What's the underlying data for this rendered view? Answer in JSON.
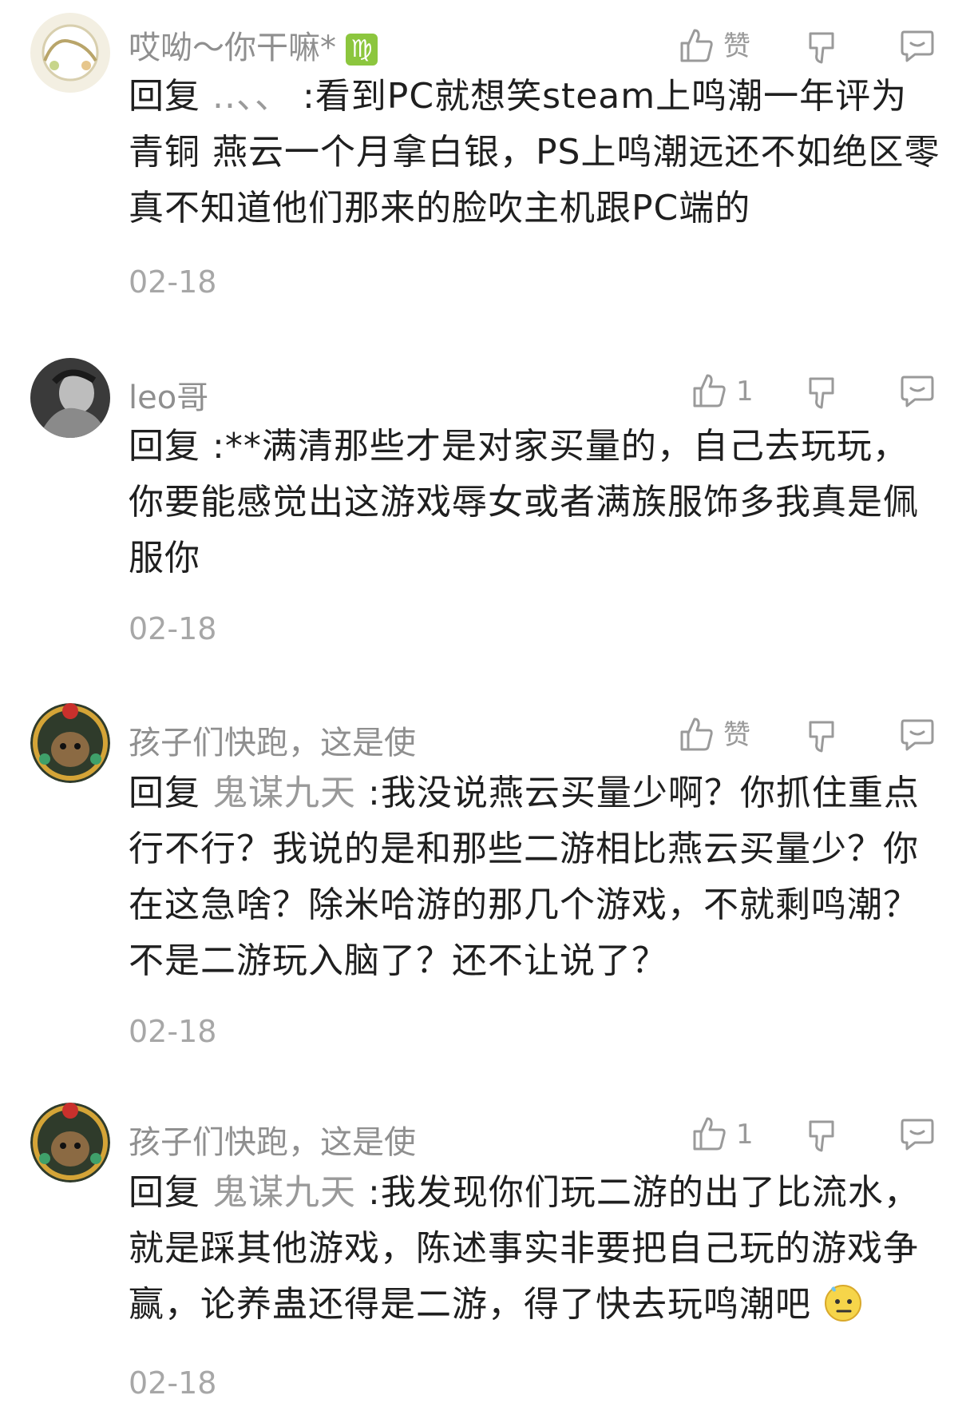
{
  "comments": [
    {
      "username": "哎呦～你干嘛*",
      "badge": "♍",
      "like_label": "赞",
      "reply_prefix": "回复",
      "mention": "..、、",
      "text": ":看到PC就想笑steam上鸣潮一年评为青铜 燕云一个月拿白银，PS上鸣潮远还不如绝区零真不知道他们那来的脸吹主机跟PC端的",
      "date": "02-18"
    },
    {
      "username": "leo哥",
      "like_label": "1",
      "reply_prefix": "回复",
      "mention": "",
      "text": ":**满清那些才是对家买量的，自己去玩玩，你要能感觉出这游戏辱女或者满族服饰多我真是佩服你",
      "date": "02-18"
    },
    {
      "username": "孩子们快跑，这是使",
      "like_label": "赞",
      "reply_prefix": "回复",
      "mention": "鬼谋九天",
      "text": ":我没说燕云买量少啊？你抓住重点行不行？我说的是和那些二游相比燕云买量少？你在这急啥？除米哈游的那几个游戏，不就剩鸣潮？不是二游玩入脑了？还不让说了？",
      "date": "02-18"
    },
    {
      "username": "孩子们快跑，这是使",
      "like_label": "1",
      "reply_prefix": "回复",
      "mention": "鬼谋九天",
      "text": ":我发现你们玩二游的出了比流水，就是踩其他游戏，陈述事实非要把自己玩的游戏争赢，论养蛊还得是二游，得了快去玩鸣潮吧",
      "date": "02-18"
    }
  ],
  "icons": {
    "like": "thumbs-up-icon",
    "dislike": "thumbs-down-icon",
    "reply": "comment-bubble-icon",
    "emoji": "sweat-face-emoji"
  },
  "colors": {
    "text": "#1f1f1f",
    "muted": "#8f8f8f",
    "badge": "#8cc63e"
  }
}
